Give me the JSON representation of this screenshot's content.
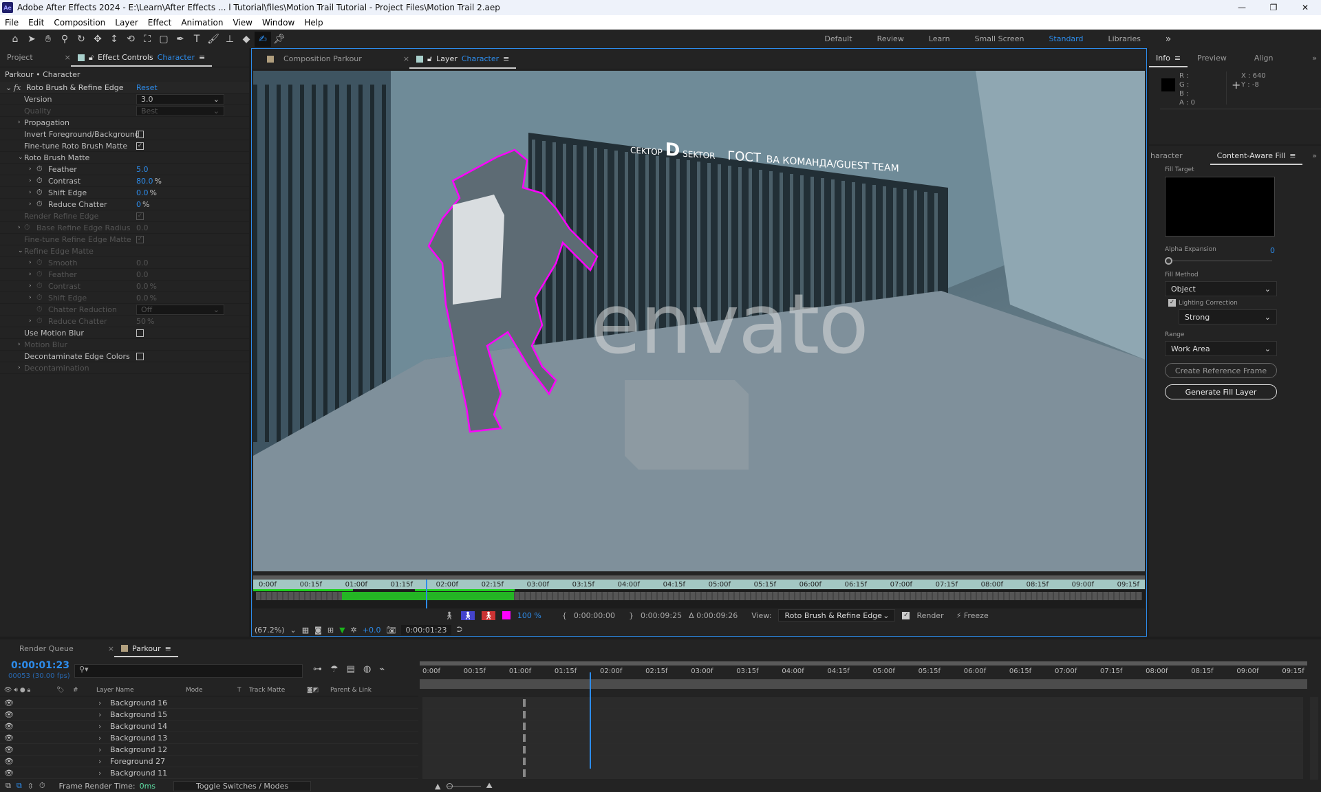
{
  "app": {
    "title": "Adobe After Effects 2024 - E:\\Learn\\After Effects ... l Tutorial\\files\\Motion Trail Tutorial - Project Files\\Motion Trail 2.aep",
    "logo": "Ae"
  },
  "menu": [
    "File",
    "Edit",
    "Composition",
    "Layer",
    "Effect",
    "Animation",
    "View",
    "Window",
    "Help"
  ],
  "tools": [
    "home-icon",
    "selection-icon",
    "hand-icon",
    "zoom-icon",
    "orbit-icon",
    "pan-icon",
    "dolly-icon",
    "rotate-icon",
    "anchor-icon",
    "rectangle-icon",
    "pen-icon",
    "type-icon",
    "brush-icon",
    "clone-stamp-icon",
    "eraser-icon",
    "roto-brush-icon",
    "puppet-pin-icon"
  ],
  "workspaces": [
    "Default",
    "Review",
    "Learn",
    "Small Screen",
    "Standard",
    "Libraries"
  ],
  "active_workspace": "Standard",
  "left_panel": {
    "tabs": {
      "project": "Project",
      "effect_controls": "Effect Controls",
      "layer_name": "Character"
    },
    "path": "Parkour • Character",
    "effect_name": "Roto Brush & Refine Edge",
    "reset": "Reset",
    "rows": [
      {
        "label": "Version",
        "value": "3.0",
        "type": "dropdown",
        "indent": 0,
        "enabled": true
      },
      {
        "label": "Quality",
        "value": "Best",
        "type": "dropdown",
        "indent": 0,
        "enabled": false
      },
      {
        "label": "Propagation",
        "type": "group",
        "indent": 0,
        "enabled": true
      },
      {
        "label": "Invert Foreground/Background",
        "type": "checkbox",
        "checked": false,
        "indent": 0,
        "enabled": true
      },
      {
        "label": "Fine-tune Roto Brush Matte",
        "type": "checkbox",
        "checked": true,
        "indent": 0,
        "enabled": true
      },
      {
        "label": "Roto Brush Matte",
        "type": "group-open",
        "indent": 0,
        "enabled": true
      },
      {
        "label": "Feather",
        "value": "5.0",
        "unit": "",
        "type": "param",
        "indent": 1,
        "enabled": true
      },
      {
        "label": "Contrast",
        "value": "80.0",
        "unit": "%",
        "type": "param",
        "indent": 1,
        "enabled": true
      },
      {
        "label": "Shift Edge",
        "value": "0.0",
        "unit": "%",
        "type": "param",
        "indent": 1,
        "enabled": true
      },
      {
        "label": "Reduce Chatter",
        "value": "0",
        "unit": "%",
        "type": "param",
        "indent": 1,
        "enabled": true
      },
      {
        "label": "Render Refine Edge",
        "type": "checkbox",
        "checked": true,
        "indent": 0,
        "enabled": false
      },
      {
        "label": "Base Refine Edge Radius",
        "value": "0.0",
        "unit": "",
        "type": "param",
        "indent": 0,
        "enabled": false
      },
      {
        "label": "Fine-tune Refine Edge Matte",
        "type": "checkbox",
        "checked": true,
        "indent": 0,
        "enabled": false
      },
      {
        "label": "Refine Edge Matte",
        "type": "group-open",
        "indent": 0,
        "enabled": false
      },
      {
        "label": "Smooth",
        "value": "0.0",
        "unit": "",
        "type": "param",
        "indent": 1,
        "enabled": false
      },
      {
        "label": "Feather",
        "value": "0.0",
        "unit": "",
        "type": "param",
        "indent": 1,
        "enabled": false
      },
      {
        "label": "Contrast",
        "value": "0.0",
        "unit": "%",
        "type": "param",
        "indent": 1,
        "enabled": false
      },
      {
        "label": "Shift Edge",
        "value": "0.0",
        "unit": "%",
        "type": "param",
        "indent": 1,
        "enabled": false
      },
      {
        "label": "Chatter Reduction",
        "value": "Off",
        "type": "param-dropdown",
        "indent": 1,
        "enabled": false
      },
      {
        "label": "Reduce Chatter",
        "value": "50",
        "unit": "%",
        "type": "param",
        "indent": 1,
        "enabled": false
      },
      {
        "label": "Use Motion Blur",
        "type": "checkbox",
        "checked": false,
        "indent": 0,
        "enabled": true
      },
      {
        "label": "Motion Blur",
        "type": "group",
        "indent": 0,
        "enabled": false
      },
      {
        "label": "Decontaminate Edge Colors",
        "type": "checkbox",
        "checked": false,
        "indent": 0,
        "enabled": true
      },
      {
        "label": "Decontamination",
        "type": "group",
        "indent": 0,
        "enabled": false
      }
    ]
  },
  "viewer": {
    "tabs": {
      "composition": "Composition Parkour",
      "layer": "Layer",
      "layer_name": "Character"
    },
    "watermark": "envato",
    "signs": [
      "CEKTOP",
      "D",
      "SEKTOR",
      "ГОСТ",
      "ВА КОМАНДА/GUEST TEAM"
    ],
    "ruler": [
      "0:00f",
      "00:15f",
      "01:00f",
      "01:15f",
      "02:00f",
      "02:15f",
      "03:00f",
      "03:15f",
      "04:00f",
      "04:15f",
      "05:00f",
      "05:15f",
      "06:00f",
      "06:15f",
      "07:00f",
      "07:15f",
      "08:00f",
      "08:15f",
      "09:00f",
      "09:15f"
    ],
    "playhead_fraction": 0.19,
    "overlay_opacity": "100 %",
    "in_time": "0:00:00:00",
    "out_time": "0:00:09:25",
    "duration": "Δ 0:00:09:26",
    "view_label": "View:",
    "view_value": "Roto Brush & Refine Edge",
    "render_label": "Render",
    "render_checked": true,
    "freeze_label": "Freeze",
    "magnification": "(67.2%)",
    "exposure": "+0.0",
    "current_time": "0:00:01:23",
    "accent": "#2d8ceb",
    "outline_color": "#ff00ff"
  },
  "info": {
    "tabs": [
      "Info",
      "Preview",
      "Align"
    ],
    "r": "R :",
    "g": "G :",
    "b": "B :",
    "a": "A :  0",
    "x": "X : 640",
    "y": "Y :  -8"
  },
  "caf": {
    "tabs": [
      "haracter",
      "Content-Aware Fill"
    ],
    "fill_target": "Fill Target",
    "alpha_label": "Alpha Expansion",
    "alpha_value": "0",
    "fill_method_label": "Fill Method",
    "fill_method": "Object",
    "lighting_label": "Lighting Correction",
    "lighting_checked": true,
    "lighting_value": "Strong",
    "range_label": "Range",
    "range_value": "Work Area",
    "create_ref": "Create Reference Frame",
    "generate": "Generate Fill Layer"
  },
  "timeline": {
    "tabs": {
      "render_queue": "Render Queue",
      "comp": "Parkour"
    },
    "timecode": "0:00:01:23",
    "frames": "00053 (30.00 fps)",
    "search_placeholder": "",
    "columns": {
      "hash": "#",
      "layer_name": "Layer Name",
      "mode": "Mode",
      "t": "T",
      "track_matte": "Track Matte",
      "parent": "Parent & Link"
    },
    "layers": [
      "Background 16",
      "Background 15",
      "Background 14",
      "Background 13",
      "Background 12",
      "Foreground 27",
      "Background 11"
    ],
    "ruler": [
      "0:00f",
      "00:15f",
      "01:00f",
      "01:15f",
      "02:00f",
      "02:15f",
      "03:00f",
      "03:15f",
      "04:00f",
      "04:15f",
      "05:00f",
      "05:15f",
      "06:00f",
      "06:15f",
      "07:00f",
      "07:15f",
      "08:00f",
      "08:15f",
      "09:00f",
      "09:15f"
    ],
    "frame_render_label": "Frame Render Time:",
    "frame_render_value": "0ms",
    "toggle": "Toggle Switches / Modes"
  }
}
